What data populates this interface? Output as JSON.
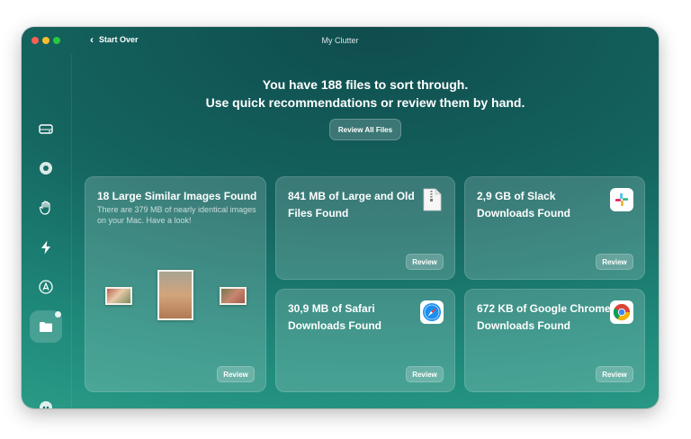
{
  "window": {
    "title": "My Clutter"
  },
  "toolbar": {
    "back_label": "Start Over"
  },
  "sidebar": {
    "items": [
      {
        "name": "disk-icon"
      },
      {
        "name": "cleanup-icon"
      },
      {
        "name": "hand-icon"
      },
      {
        "name": "lightning-icon"
      },
      {
        "name": "applications-icon"
      },
      {
        "name": "folder-icon",
        "active": true
      }
    ],
    "assistant": "assistant-icon"
  },
  "header": {
    "line1": "You have 188 files to sort through.",
    "line2": "Use quick recommendations or review them by hand.",
    "review_all_label": "Review All Files"
  },
  "cards": {
    "images": {
      "title": "18 Large Similar Images Found",
      "description": "There are 379 MB of nearly identical images on your Mac. Have a look!",
      "button": "Review"
    },
    "large_files": {
      "title": "841 MB of Large and Old Files Found",
      "button": "Review",
      "icon": "zip-file-icon"
    },
    "slack": {
      "title": "2,9 GB of Slack Downloads Found",
      "button": "Review",
      "icon": "slack-icon"
    },
    "safari": {
      "title": "30,9 MB of Safari Downloads Found",
      "button": "Review",
      "icon": "safari-icon"
    },
    "chrome": {
      "title": "672 KB of Google Chrome Downloads Found",
      "button": "Review",
      "icon": "chrome-icon"
    }
  },
  "colors": {
    "accent": "#14645f",
    "slack_purple": "#4a154b",
    "safari_blue": "#1b8ff0"
  }
}
